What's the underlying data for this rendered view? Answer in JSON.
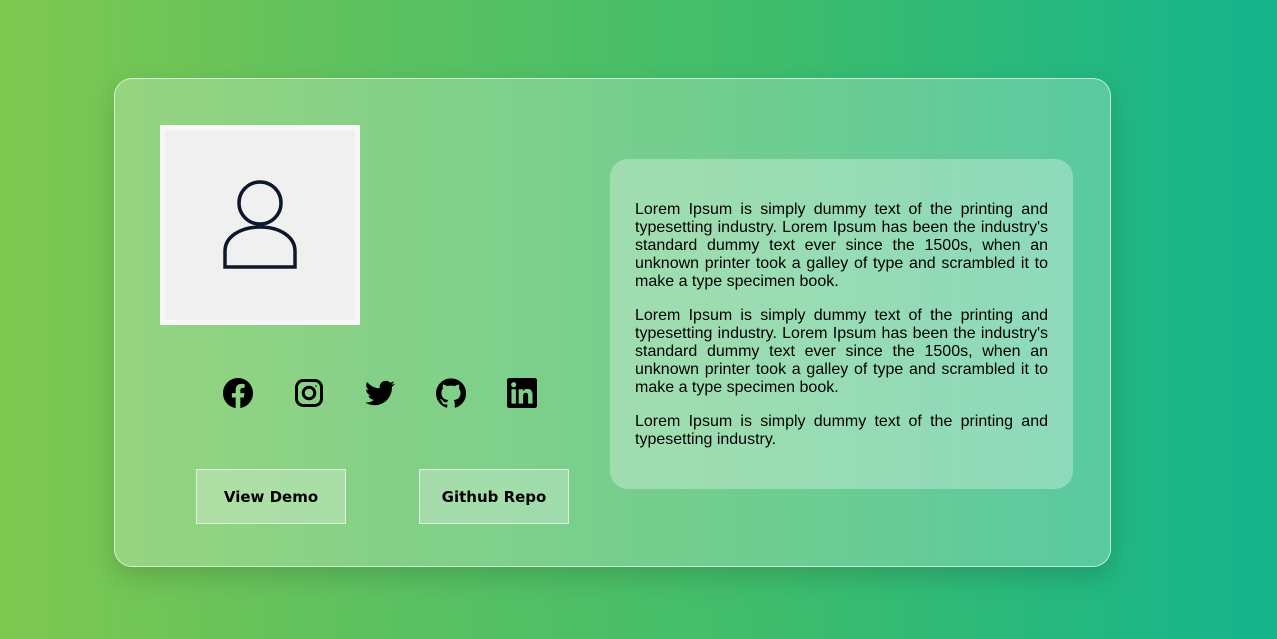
{
  "profile": {
    "avatar_icon": "user-icon"
  },
  "socials": [
    {
      "icon": "facebook-icon"
    },
    {
      "icon": "instagram-icon"
    },
    {
      "icon": "twitter-icon"
    },
    {
      "icon": "github-icon"
    },
    {
      "icon": "linkedin-icon"
    }
  ],
  "buttons": {
    "demo_label": "View Demo",
    "repo_label": "Github Repo"
  },
  "description": {
    "paragraphs": [
      "Lorem Ipsum is simply dummy text of the printing and typesetting industry. Lorem Ipsum has been the industry's standard dummy text ever since the 1500s, when an unknown printer took a galley of type and scrambled it to make a type specimen book.",
      "Lorem Ipsum is simply dummy text of the printing and typesetting industry. Lorem Ipsum has been the industry's standard dummy text ever since the 1500s, when an unknown printer took a galley of type and scrambled it to make a type specimen book.",
      "Lorem Ipsum is simply dummy text of the printing and typesetting industry."
    ]
  },
  "colors": {
    "background_start": "#7ec850",
    "background_end": "#14b48c",
    "icon": "#000000",
    "avatar_stroke": "#0f172a"
  }
}
